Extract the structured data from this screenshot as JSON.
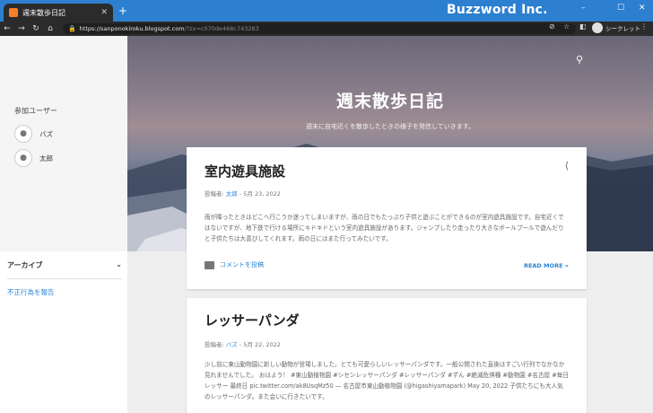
{
  "browser": {
    "tab_title": "週末散歩日記",
    "tab_close": "✕",
    "new_tab": "+",
    "watermark": "Buzzword Inc.",
    "url_host": "https://sanponokiroku.blogspot.com",
    "url_path": "/?zx=c070de468c743283",
    "incognito_label": "シークレット"
  },
  "sidebar": {
    "heading": "参加ユーザー",
    "users": [
      {
        "name": "バズ"
      },
      {
        "name": "太郎"
      }
    ],
    "archive_label": "アーカイブ",
    "report_link": "不正行為を報告"
  },
  "header": {
    "title": "週末散歩日記",
    "description": "週末に自宅近くを散歩したときの様子を発信していきます。"
  },
  "posts": [
    {
      "title": "室内遊具施設",
      "meta_prefix": "投稿者: ",
      "author": "太郎",
      "date": " - 5月 23, 2022",
      "body": "雨が降ったときはどこへ行こうか迷ってしまいますが、雨の日でもたっぷり子供と遊ぶことができるのが室内遊具施設です。自宅近くではないですが、地下鉄で行ける場所にキドキドという室内遊具施設があります。ジャンプしたり走ったり大きなボールプールで遊んだりと子供たちは大喜びしてくれます。雨の日にはまた行ってみたいです。",
      "comments": "コメントを投稿",
      "read_more": "READ MORE »"
    },
    {
      "title": "レッサーパンダ",
      "meta_prefix": "投稿者: ",
      "author": "バズ",
      "date": " - 5月 22, 2022",
      "body": "少し前に東山動物園に新しい動物が登場しました。とても可愛らしいレッサーパンダです。一般公開された直後はすごい行列でなかなか見れませんでした。 おはよう！ #東山動植物園 #シセンレッサーパンダ #レッサーパンダ #ずん #絶滅危惧種 #動物園 #名古屋 #毎日レッサー 最終日 pic.twitter.com/ak8UsqMz50 — 名古屋市東山動植物園 (@higashiyamapark) May 20, 2022 子供たちにも大人気のレッサーパンダ。また会いに行きたいです。"
    }
  ]
}
